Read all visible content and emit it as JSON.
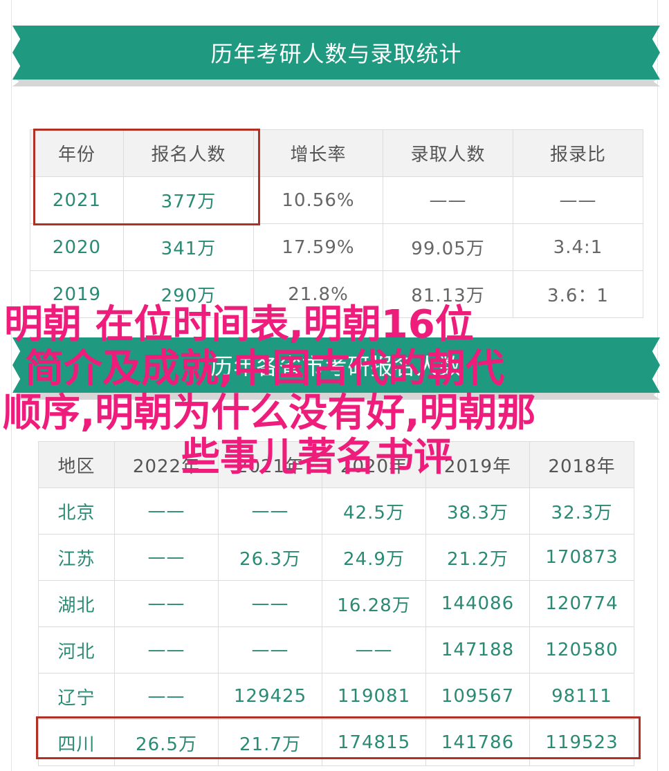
{
  "banner1": {
    "title": "历年考研人数与录取统计"
  },
  "table1": {
    "headers": [
      "年份",
      "报名人数",
      "增长率",
      "录取人数",
      "报录比"
    ],
    "rows": [
      [
        "2021",
        "377万",
        "10.56%",
        "——",
        "——"
      ],
      [
        "2020",
        "341万",
        "17.59%",
        "99.05万",
        "3.4:1"
      ],
      [
        "2019",
        "290万",
        "21.8%",
        "81.13万",
        "3.6：1"
      ]
    ]
  },
  "banner2": {
    "title": "历年各省市考研报名人数"
  },
  "table2": {
    "headers": [
      "地区",
      "2022年",
      "2021年",
      "2020年",
      "2019年",
      "2018年"
    ],
    "rows": [
      [
        "北京",
        "——",
        "——",
        "42.5万",
        "38.3万",
        "32.3万"
      ],
      [
        "江苏",
        "——",
        "26.3万",
        "24.9万",
        "21.2万",
        "170873"
      ],
      [
        "湖北",
        "——",
        "——",
        "16.28万",
        "144086",
        "120774"
      ],
      [
        "河北",
        "——",
        "——",
        "——",
        "147188",
        "120580"
      ],
      [
        "辽宁",
        "——",
        "129425",
        "119081",
        "109567",
        "98111"
      ],
      [
        "四川",
        "26.5万",
        "21.7万",
        "174815",
        "141786",
        "119523"
      ]
    ]
  },
  "overlay": {
    "line1": "明朝  在位时间表,明朝16位",
    "line2": "简介及成就,中国古代的朝代",
    "line3": "顺序,明朝为什么没有好,明朝那",
    "line4": "些事儿著名书评"
  },
  "colors": {
    "ribbon": "#1f9a80",
    "green_text": "#2a8a74",
    "highlight_box": "#b03024",
    "overlay_text": "#ee1c7b"
  }
}
